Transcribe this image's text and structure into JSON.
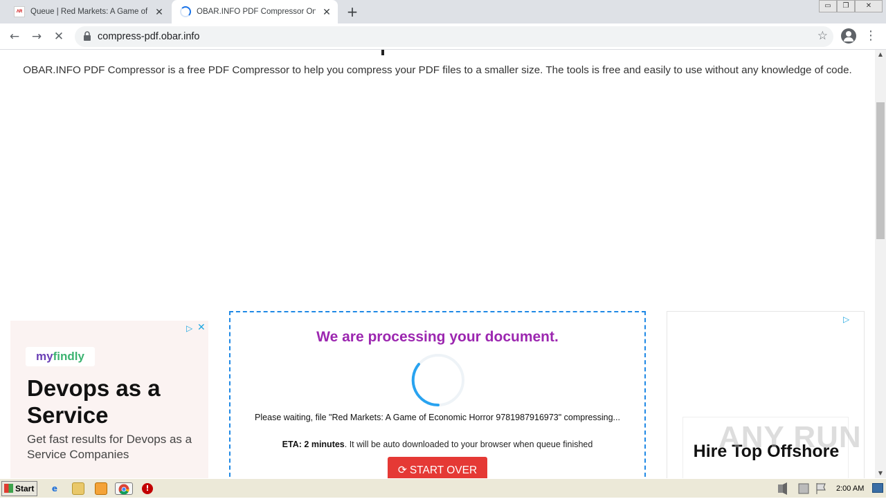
{
  "tabs": [
    {
      "title": "Queue | Red Markets: A Game of Ec",
      "favicon": "rm-favicon",
      "favicon_text": "ΛR"
    },
    {
      "title": "OBAR.INFO PDF Compressor Online",
      "favicon": "loading-spinner-icon"
    }
  ],
  "toolbar": {
    "url": "compress-pdf.obar.info",
    "back_icon": "←",
    "forward_icon": "→",
    "stop_icon": "✕",
    "star_icon": "☆",
    "menu_icon": "⋮",
    "new_tab_icon": "+",
    "tab_close_icon": "✕"
  },
  "window_controls": {
    "minimize": "▭",
    "restore": "❐",
    "close": "✕"
  },
  "page": {
    "intro": "OBAR.INFO PDF Compressor is a free PDF Compressor to help you compress your PDF files to a smaller size. The tools is free and easily to use without any knowledge of code."
  },
  "ad_left": {
    "brand_prefix": "my",
    "brand_suffix": "findly",
    "headline": "Devops as a Service",
    "subtext": "Get fast results for Devops as a Service Companies",
    "choices_icon": "▷",
    "close_icon": "✕"
  },
  "processing": {
    "title": "We are processing your document.",
    "file_text": "Please waiting, file \"Red Markets: A Game of Economic Horror 9781987916973\" compressing...",
    "eta_label": "ETA:",
    "eta_value": "2 minutes",
    "eta_rest": ". It will be auto downloaded to your browser when queue finished",
    "button_label": "START OVER",
    "button_icon": "⟳"
  },
  "ad_right": {
    "headline": "Hire Top Offshore",
    "choices_icon": "▷"
  },
  "watermark": "ANY RUN",
  "scrollbar": {
    "up_icon": "▲",
    "down_icon": "▼"
  },
  "taskbar": {
    "start_label": "Start",
    "clock": "2:00 AM"
  },
  "colors": {
    "accent_purple": "#9c27b0",
    "button_red": "#e53935",
    "dashed_blue": "#1e88e5",
    "spinner_blue": "#29a3f0"
  }
}
